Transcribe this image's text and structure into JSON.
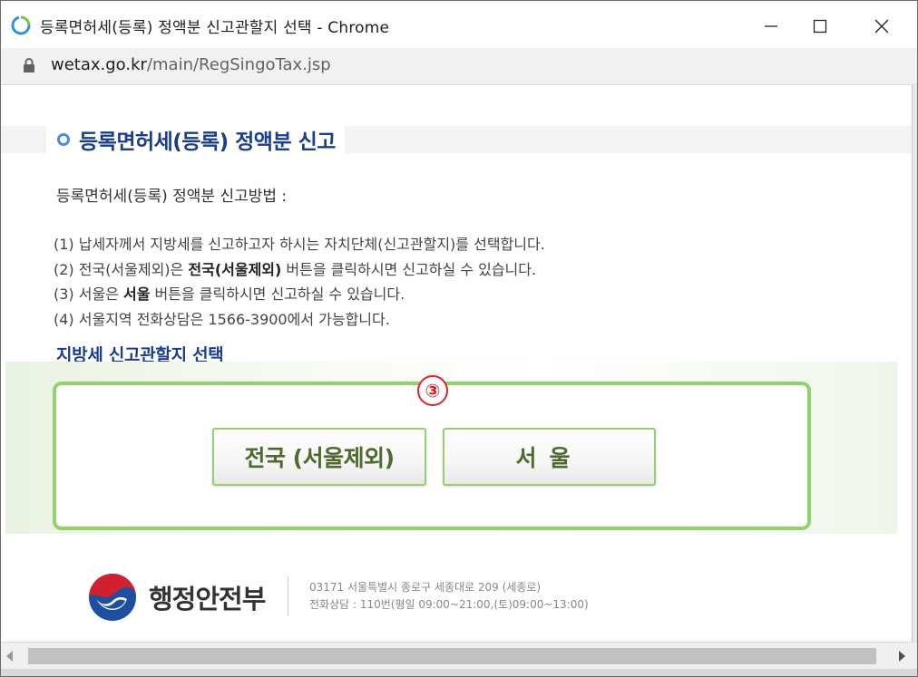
{
  "window": {
    "title": "등록면허세(등록) 정액분 신고관할지 선택 - Chrome",
    "url_host": "wetax.go.kr",
    "url_path": "/main/RegSingoTax.jsp"
  },
  "page": {
    "header_title": "등록면허세(등록) 정액분 신고",
    "method_title": "등록면허세(등록) 정액분 신고방법 :",
    "steps": [
      {
        "text": "(1) 납세자께서 지방세를 신고하고자 하시는 자치단체(신고관할지)를 선택합니다."
      },
      {
        "pre": "(2) 전국(서울제외)은 ",
        "bold": "전국(서울제외)",
        "post": " 버튼을 클릭하시면 신고하실 수 있습니다."
      },
      {
        "pre": "(3) 서울은 ",
        "bold": "서울",
        "post": " 버튼을 클릭하시면 신고하실 수 있습니다."
      },
      {
        "text": "(4) 서울지역 전화상담은 1566-3900에서 가능합니다."
      }
    ],
    "select_title": "지방세 신고관할지 선택",
    "step_marker": "③",
    "btn_nation": "전국 (서울제외)",
    "btn_seoul": "서울"
  },
  "footer": {
    "ministry": "행정안전부",
    "address": "03171 서울특별시 종로구 세종대로 209 (세종로)",
    "phone": "전화상담 : 110번(평일 09:00~21:00,(토)09:00~13:00)"
  },
  "colors": {
    "accent_green": "#8fd36a",
    "title_blue": "#1b3e8c",
    "marker_red": "#e0202a"
  },
  "icons": [
    "chrome-app-icon",
    "minimize-icon",
    "maximize-icon",
    "close-icon",
    "lock-icon",
    "circle-bullet-icon",
    "government-logo-icon",
    "scroll-left-icon",
    "scroll-right-icon"
  ]
}
